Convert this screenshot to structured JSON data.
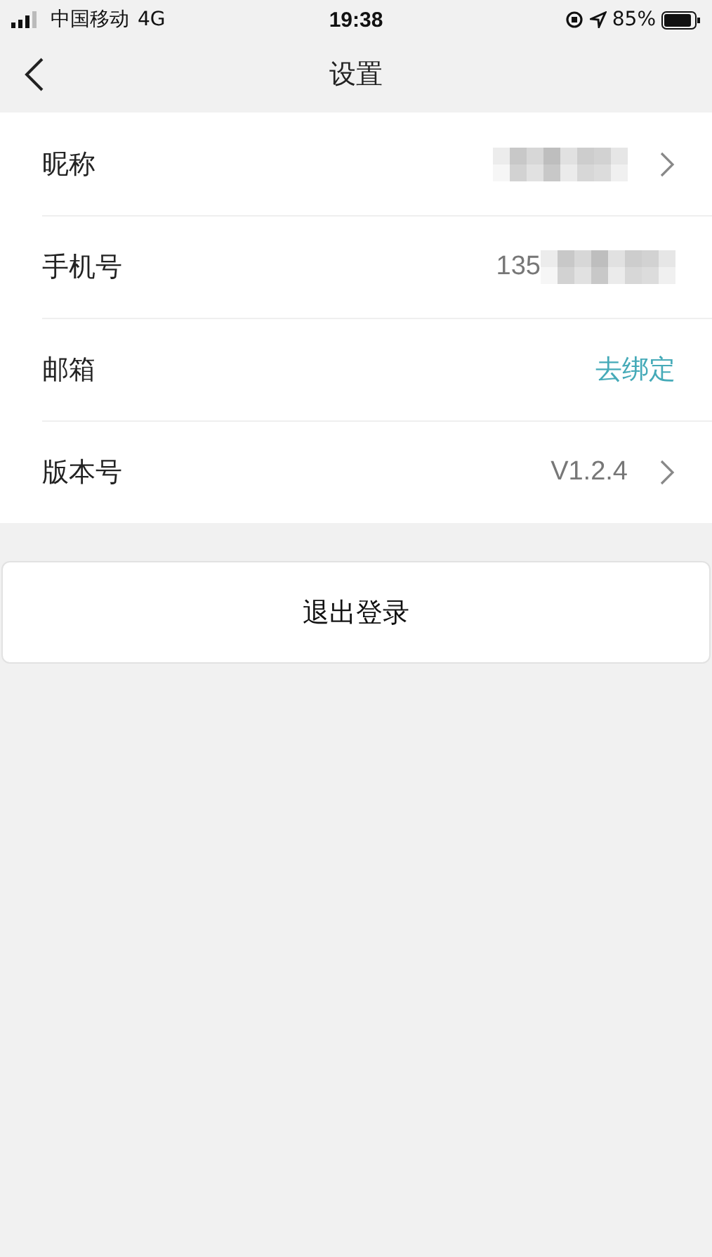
{
  "status_bar": {
    "carrier": "中国移动",
    "network": "4G",
    "time": "19:38",
    "battery": "85%"
  },
  "nav": {
    "title": "设置"
  },
  "rows": [
    {
      "label": "昵称",
      "kind": "value",
      "blurred": true,
      "chevron": true
    },
    {
      "label": "手机号",
      "kind": "value",
      "value": "135",
      "blurred": true,
      "chevron": false
    },
    {
      "label": "邮箱",
      "kind": "link",
      "value": "去绑定",
      "chevron": false
    },
    {
      "label": "版本号",
      "kind": "value",
      "value": "V1.2.4",
      "blurred": false,
      "chevron": true
    }
  ],
  "logout_button": "退出登录"
}
